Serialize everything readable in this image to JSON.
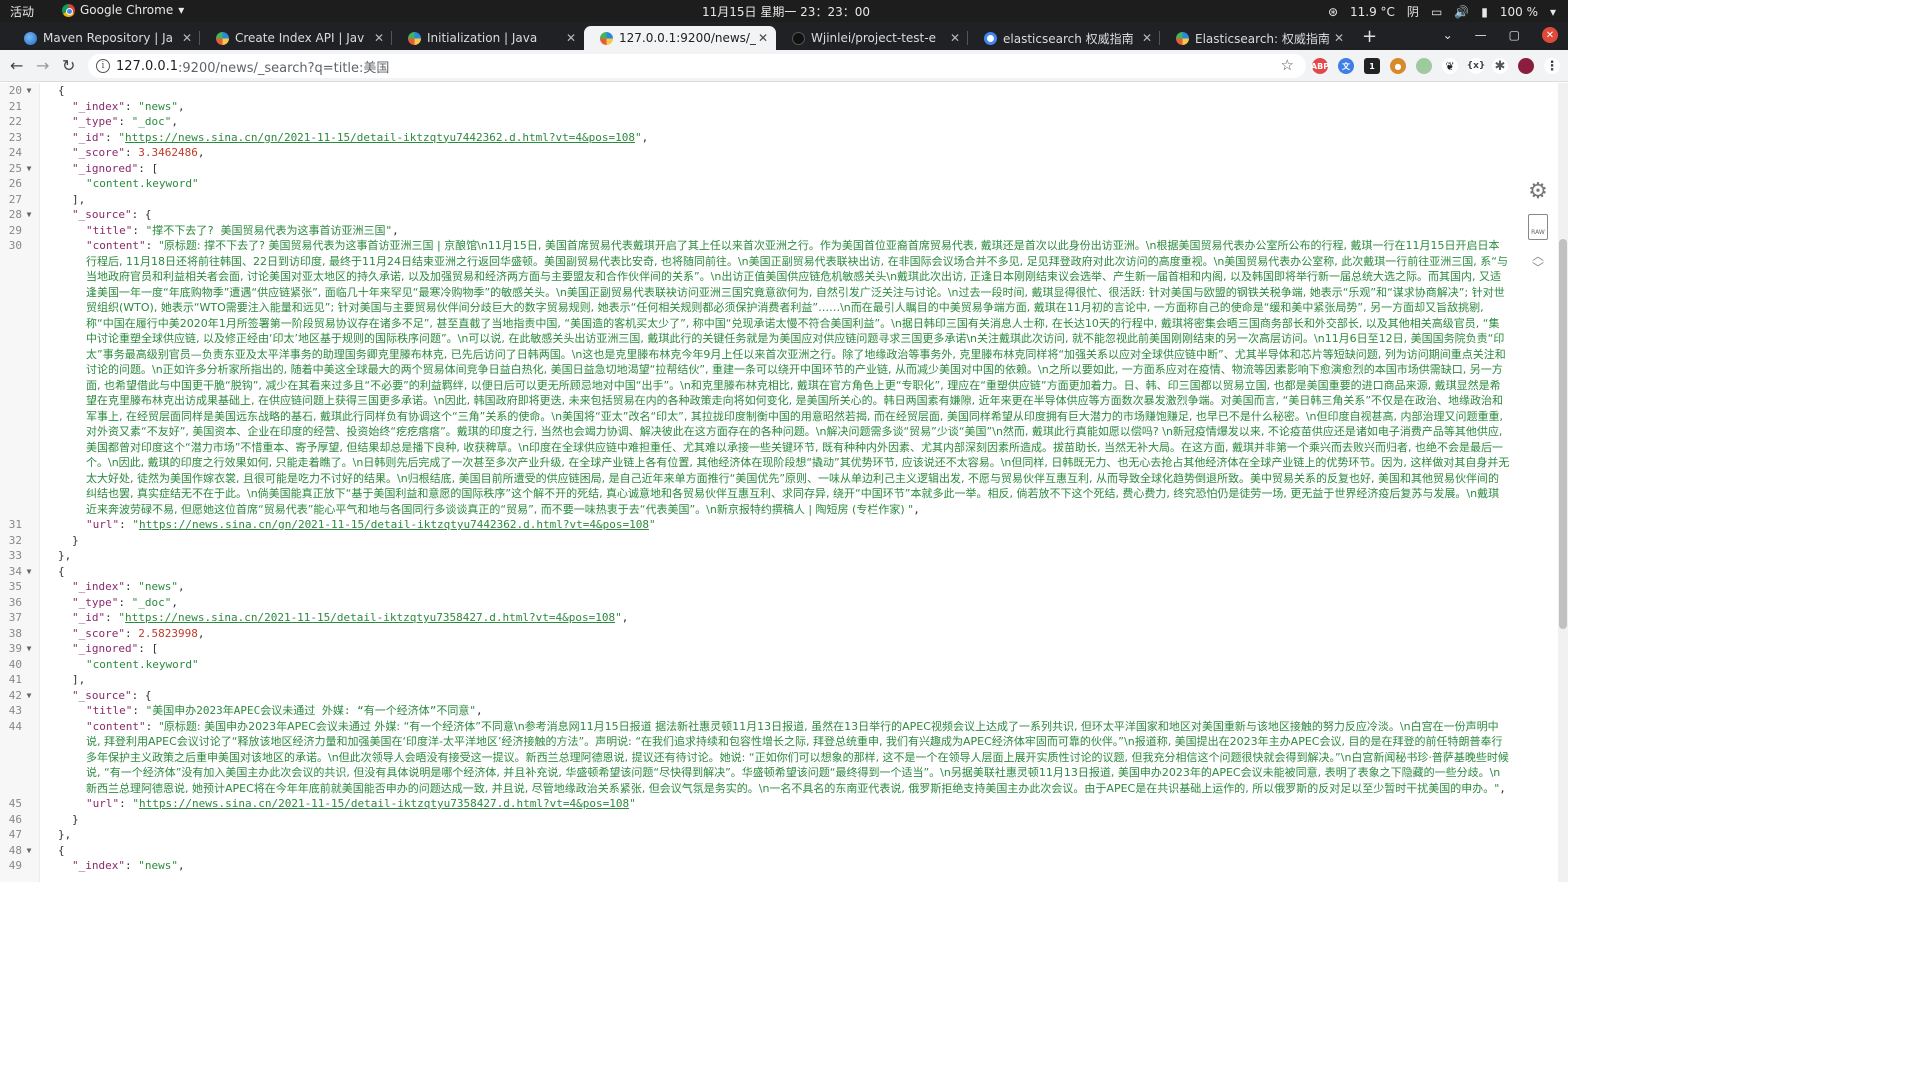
{
  "topbar": {
    "activities": "活动",
    "app": "Google Chrome",
    "clock": "11月15日 星期一 23：23：00",
    "temp": "11.9 °C",
    "weather": "阴",
    "battery": "100 %"
  },
  "tabs": [
    {
      "title": "Maven Repository | Ja",
      "active": false,
      "favicon": "maven-icon"
    },
    {
      "title": "Create Index API | Jav",
      "active": false,
      "favicon": "json-icon"
    },
    {
      "title": "Initialization | Java",
      "active": false,
      "favicon": "json-icon"
    },
    {
      "title": "127.0.0.1:9200/news/_s",
      "active": true,
      "favicon": "json-icon"
    },
    {
      "title": "Wjinlei/project-test-e",
      "active": false,
      "favicon": "github-icon"
    },
    {
      "title": "elasticsearch 权威指南",
      "active": false,
      "favicon": "google-icon"
    },
    {
      "title": "Elasticsearch: 权威指南",
      "active": false,
      "favicon": "json-icon"
    }
  ],
  "address": {
    "host": "127.0.0.1",
    "path": ":9200/news/_search?q=title:美国"
  },
  "lines": [
    {
      "n": "20",
      "fold": true,
      "indent": 2,
      "parts": [
        [
          "punc",
          "{"
        ]
      ]
    },
    {
      "n": "21",
      "indent": 3,
      "parts": [
        [
          "key",
          "\"_index\""
        ],
        [
          "punc",
          ": "
        ],
        [
          "str",
          "\"news\""
        ],
        [
          "punc",
          ","
        ]
      ]
    },
    {
      "n": "22",
      "indent": 3,
      "parts": [
        [
          "key",
          "\"_type\""
        ],
        [
          "punc",
          ": "
        ],
        [
          "str",
          "\"_doc\""
        ],
        [
          "punc",
          ","
        ]
      ]
    },
    {
      "n": "23",
      "indent": 3,
      "parts": [
        [
          "key",
          "\"_id\""
        ],
        [
          "punc",
          ": "
        ],
        [
          "str",
          "\""
        ],
        [
          "url",
          "https://news.sina.cn/gn/2021-11-15/detail-iktzqtyu7442362.d.html?vt=4&pos=108"
        ],
        [
          "str",
          "\""
        ],
        [
          "punc",
          ","
        ]
      ]
    },
    {
      "n": "24",
      "indent": 3,
      "parts": [
        [
          "key",
          "\"_score\""
        ],
        [
          "punc",
          ": "
        ],
        [
          "num",
          "3.3462486"
        ],
        [
          "punc",
          ","
        ]
      ]
    },
    {
      "n": "25",
      "fold": true,
      "indent": 3,
      "parts": [
        [
          "key",
          "\"_ignored\""
        ],
        [
          "punc",
          ": ["
        ]
      ]
    },
    {
      "n": "26",
      "indent": 4,
      "parts": [
        [
          "str",
          "\"content.keyword\""
        ]
      ]
    },
    {
      "n": "27",
      "indent": 3,
      "parts": [
        [
          "punc",
          "],"
        ]
      ]
    },
    {
      "n": "28",
      "fold": true,
      "indent": 3,
      "parts": [
        [
          "key",
          "\"_source\""
        ],
        [
          "punc",
          ": {"
        ]
      ]
    },
    {
      "n": "29",
      "indent": 4,
      "parts": [
        [
          "key",
          "\"title\""
        ],
        [
          "punc",
          ": "
        ],
        [
          "str",
          "\"撑不下去了? 美国贸易代表为这事首访亚洲三国\""
        ],
        [
          "punc",
          ","
        ]
      ]
    },
    {
      "n": "30",
      "indent": 4,
      "parts": [
        [
          "key",
          "\"content\""
        ],
        [
          "punc",
          ": "
        ],
        [
          "cont",
          "\"原标题: 撑不下去了? 美国贸易代表为这事首访亚洲三国 | 京酿馆\\n11月15日, 美国首席贸易代表戴琪开启了其上任以来首次亚洲之行。作为美国首位亚裔首席贸易代表, 戴琪还是首次以此身份出访亚洲。\\n根据美国贸易代表办公室所公布的行程, 戴琪一行在11月15日开启日本行程后, 11月18日还将前往韩国、22日到访印度, 最终于11月24日结束亚洲之行返回华盛顿。美国副贸易代表比安奇, 也将随同前往。\\n美国正副贸易代表联袂出访, 在非国际会议场合并不多见, 足见拜登政府对此次访问的高度重视。\\n美国贸易代表办公室称, 此次戴琪一行前往亚洲三国, 系“与当地政府官员和利益相关者会面, 讨论美国对亚太地区的持久承诺, 以及加强贸易和经济两方面与主要盟友和合作伙伴间的关系”。\\n出访正值美国供应链危机敏感关头\\n戴琪此次出访, 正逢日本刚刚结束议会选举、产生新一届首相和内阁, 以及韩国即将举行新一届总统大选之际。而其国内, 又适逢美国一年一度“年底购物季”遭遇“供应链紧张”, 面临几十年来罕见“最寒冷购物季”的敏感关头。\\n美国正副贸易代表联袂访问亚洲三国究竟意欲何为, 自然引发广泛关注与讨论。\\n过去一段时间, 戴琪显得很忙、很活跃: 针对美国与欧盟的钢铁关税争端, 她表示“乐观”和“谋求协商解决”; 针对世贸组织(WTO), 她表示“WTO需要注入能量和远见”; 针对美国与主要贸易伙伴间分歧巨大的数字贸易规则, 她表示“任何相关规则都必须保护消费者利益”……\\n而在最引人瞩目的中美贸易争端方面, 戴琪在11月初的言论中, 一方面称自己的使命是“缓和美中紧张局势”, 另一方面却又旨敌挑剔, 称“中国在履行中美2020年1月所签署第一阶段贸易协议存在诸多不足”, 甚至直截了当地指责中国, “美国造的客机买太少了”, 称中国“兑现承诺太慢不符合美国利益”。\\n据日韩印三国有关消息人士称, 在长达10天的行程中, 戴琪将密集会晤三国商务部长和外交部长, 以及其他相关高级官员, “集中讨论重塑全球供应链, 以及修正经由‘印太’地区基于规则的国际秩序问题”。\\n可以说, 在此敏感关头出访亚洲三国, 戴琪此行的关键任务就是为美国应对供应链问题寻求三国更多承诺\\n关注戴琪此次访问, 就不能忽视此前美国刚刚结束的另一次高层访问。\\n11月6日至12日, 美国国务院负责“印太”事务最高级别官员—负责东亚及太平洋事务的助理国务卿克里滕布林克, 已先后访问了日韩两国。\\n这也是克里滕布林克今年9月上任以来首次亚洲之行。除了地缘政治等事务外, 克里滕布林克同样将“加强关系以应对全球供应链中断”、尤其半导体和芯片等短缺问题, 列为访问期间重点关注和讨论的问题。\\n正如许多分析家所指出的, 随着中美这全球最大的两个贸易体间竞争日益白热化, 美国日益急切地渴望“拉帮结伙”, 重建一条可以绕开中国环节的产业链, 从而减少美国对中国的依赖。\\n之所以要如此, 一方面系应对在疫情、物流等因素影响下愈演愈烈的本国市场供需缺口, 另一方面, 也希望借此与中国更干脆“脱钩”, 减少在其看来过多且“不必要”的利益羁绊, 以便日后可以更无所顾忌地对中国“出手”。\\n和克里滕布林克相比, 戴琪在官方角色上更“专职化”, 理应在“重塑供应链”方面更加着力。日、韩、印三国都以贸易立国, 也都是美国重要的进口商品来源, 戴琪显然是希望在克里滕布林克出访成果基础上, 在供应链问题上获得三国更多承诺。\\n因此, 韩国政府即将更迭, 未来包括贸易在内的各种政策走向将如何变化, 是美国所关心的。韩日两国素有嫌隙, 近年来更在半导体供应等方面数次暴发激烈争端。对美国而言, “美日韩三角关系”不仅是在政治、地缘政治和军事上, 在经贸层面同样是美国远东战略的基石, 戴琪此行同样负有协调这个“三角”关系的使命。\\n美国将“亚太”改名“印太”, 其拉拢印度制衡中国的用意昭然若揭, 而在经贸层面, 美国同样希望从印度拥有巨大潜力的市场赚饱赚足, 也早已不是什么秘密。\\n但印度自视甚高, 内部治理又问题重重, 对外资又素“不友好”, 美国资本、企业在印度的经营、投资始终“疙疙瘩瘩”。戴琪的印度之行, 当然也会竭力协调、解决彼此在这方面存在的各种问题。\\n解决问题需多谈“贸易”少谈“美国”\\n然而, 戴琪此行真能如愿以偿吗? \\n新冠疫情爆发以来, 不论疫苗供应还是诸如电子消费产品等其他供应, 美国都曾对印度这个“潜力市场”不惜重本、寄予厚望, 但结果却总是播下良种, 收获稗草。\\n印度在全球供应链中难担重任、尤其难以承接一些关键环节, 既有种种内外因素、尤其内部深刻因素所造成。拔苗助长, 当然无补大局。在这方面, 戴琪并非第一个乘兴而去败兴而归者, 也绝不会是最后一个。\\n因此, 戴琪的印度之行效果如何, 只能走着瞧了。\\n日韩则先后完成了一次甚至多次产业升级, 在全球产业链上各有位置, 其他经济体在现阶段想“撬动”其优势环节, 应该说还不太容易。\\n但同样, 日韩既无力、也无心去抢占其他经济体在全球产业链上的优势环节。因为, 这样做对其自身并无太大好处, 徒然为美国作嫁衣裳, 且很可能是吃力不讨好的结果。\\n归根结底, 美国目前所遭受的供应链困局, 是自己近年来单方面推行“美国优先”原则、一味从单边利己主义逻辑出发, 不愿与贸易伙伴互惠互利, 从而导致全球化趋势倒退所致。美中贸易关系的反复也好, 美国和其他贸易伙伴间的纠结也罢, 真实症结无不在于此。\\n倘美国能真正放下“基于美国利益和意愿的国际秩序”这个解不开的死结, 真心诚意地和各贸易伙伴互惠互利、求同存异, 绕开“中国环节”本就多此一举。相反, 倘若放不下这个死结, 费心费力, 终究恐怕仍是徒劳一场, 更无益于世界经济疫后复苏与发展。\\n戴琪近来奔波劳碌不易, 但愿她这位首席“贸易代表”能心平气和地与各国同行多谈谈真正的“贸易”, 而不要一味热衷于去“代表美国”。\\n新京报特约撰稿人 | 陶短房 (专栏作家) \""
        ],
        [
          "punc",
          ","
        ]
      ]
    },
    {
      "n": "31",
      "indent": 4,
      "parts": [
        [
          "key",
          "\"url\""
        ],
        [
          "punc",
          ": "
        ],
        [
          "str",
          "\""
        ],
        [
          "url",
          "https://news.sina.cn/gn/2021-11-15/detail-iktzqtyu7442362.d.html?vt=4&pos=108"
        ],
        [
          "str",
          "\""
        ]
      ]
    },
    {
      "n": "32",
      "indent": 3,
      "parts": [
        [
          "punc",
          "}"
        ]
      ]
    },
    {
      "n": "33",
      "indent": 2,
      "parts": [
        [
          "punc",
          "},"
        ]
      ]
    },
    {
      "n": "34",
      "fold": true,
      "indent": 2,
      "parts": [
        [
          "punc",
          "{"
        ]
      ]
    },
    {
      "n": "35",
      "indent": 3,
      "parts": [
        [
          "key",
          "\"_index\""
        ],
        [
          "punc",
          ": "
        ],
        [
          "str",
          "\"news\""
        ],
        [
          "punc",
          ","
        ]
      ]
    },
    {
      "n": "36",
      "indent": 3,
      "parts": [
        [
          "key",
          "\"_type\""
        ],
        [
          "punc",
          ": "
        ],
        [
          "str",
          "\"_doc\""
        ],
        [
          "punc",
          ","
        ]
      ]
    },
    {
      "n": "37",
      "indent": 3,
      "parts": [
        [
          "key",
          "\"_id\""
        ],
        [
          "punc",
          ": "
        ],
        [
          "str",
          "\""
        ],
        [
          "url",
          "https://news.sina.cn/2021-11-15/detail-iktzqtyu7358427.d.html?vt=4&pos=108"
        ],
        [
          "str",
          "\""
        ],
        [
          "punc",
          ","
        ]
      ]
    },
    {
      "n": "38",
      "indent": 3,
      "parts": [
        [
          "key",
          "\"_score\""
        ],
        [
          "punc",
          ": "
        ],
        [
          "num",
          "2.5823998"
        ],
        [
          "punc",
          ","
        ]
      ]
    },
    {
      "n": "39",
      "fold": true,
      "indent": 3,
      "parts": [
        [
          "key",
          "\"_ignored\""
        ],
        [
          "punc",
          ": ["
        ]
      ]
    },
    {
      "n": "40",
      "indent": 4,
      "parts": [
        [
          "str",
          "\"content.keyword\""
        ]
      ]
    },
    {
      "n": "41",
      "indent": 3,
      "parts": [
        [
          "punc",
          "],"
        ]
      ]
    },
    {
      "n": "42",
      "fold": true,
      "indent": 3,
      "parts": [
        [
          "key",
          "\"_source\""
        ],
        [
          "punc",
          ": {"
        ]
      ]
    },
    {
      "n": "43",
      "indent": 4,
      "parts": [
        [
          "key",
          "\"title\""
        ],
        [
          "punc",
          ": "
        ],
        [
          "str",
          "\"美国申办2023年APEC会议未通过 外媒: “有一个经济体”不同意\""
        ],
        [
          "punc",
          ","
        ]
      ]
    },
    {
      "n": "44",
      "indent": 4,
      "parts": [
        [
          "key",
          "\"content\""
        ],
        [
          "punc",
          ": "
        ],
        [
          "cont",
          "\"原标题: 美国申办2023年APEC会议未通过 外媒: “有一个经济体”不同意\\n参考消息网11月15日报道 据法新社惠灵顿11月13日报道, 虽然在13日举行的APEC视频会议上达成了一系列共识, 但环太平洋国家和地区对美国重新与该地区接触的努力反应冷淡。\\n白宫在一份声明中说, 拜登利用APEC会议讨论了“释放该地区经济力量和加强美国在‘印度洋-太平洋地区’经济接触的方法”。声明说: “在我们追求持续和包容性增长之际, 拜登总统重申, 我们有兴趣成为APEC经济体牢固而可靠的伙伴。”\\n报道称, 美国提出在2023年主办APEC会议, 目的是在拜登的前任特朗普奉行多年保护主义政策之后重申美国对该地区的承诺。\\n但此次领导人会晤没有接受这一提议。新西兰总理阿德恩说, 提议还有待讨论。她说: “正如你们可以想象的那样, 这不是一个在领导人层面上展开实质性讨论的议题, 但我充分相信这个问题很快就会得到解决。”\\n白宫新闻秘书珍·普萨基晚些时候说, “有一个经济体”没有加入美国主办此次会议的共识, 但没有具体说明是哪个经济体, 并且补充说, 华盛顿希望该问题“尽快得到解决”。华盛顿希望该问题“最终得到一个适当”。\\n另据美联社惠灵顿11月13日报道, 美国申办2023年的APEC会议未能被同意, 表明了表象之下隐藏的一些分歧。\\n新西兰总理阿德恩说, 她预计APEC将在今年年底前就美国能否申办的问题达成一致, 并且说, 尽管地缘政治关系紧张, 但会议气氛是务实的。\\n一名不具名的东南亚代表说, 俄罗斯拒绝支持美国主办此次会议。由于APEC是在共识基础上运作的, 所以俄罗斯的反对足以至少暂时干扰美国的申办。\""
        ],
        [
          "punc",
          ","
        ]
      ]
    },
    {
      "n": "45",
      "indent": 4,
      "parts": [
        [
          "key",
          "\"url\""
        ],
        [
          "punc",
          ": "
        ],
        [
          "str",
          "\""
        ],
        [
          "url",
          "https://news.sina.cn/2021-11-15/detail-iktzqtyu7358427.d.html?vt=4&pos=108"
        ],
        [
          "str",
          "\""
        ]
      ]
    },
    {
      "n": "46",
      "indent": 3,
      "parts": [
        [
          "punc",
          "}"
        ]
      ]
    },
    {
      "n": "47",
      "indent": 2,
      "parts": [
        [
          "punc",
          "},"
        ]
      ]
    },
    {
      "n": "48",
      "fold": true,
      "indent": 2,
      "parts": [
        [
          "punc",
          "{"
        ]
      ]
    },
    {
      "n": "49",
      "indent": 3,
      "parts": [
        [
          "key",
          "\"_index\""
        ],
        [
          "punc",
          ": "
        ],
        [
          "str",
          "\"news\""
        ],
        [
          "punc",
          ","
        ]
      ]
    }
  ],
  "icons": {
    "settings": "gear-icon",
    "raw": "raw-icon",
    "raw_label": "RAW"
  }
}
